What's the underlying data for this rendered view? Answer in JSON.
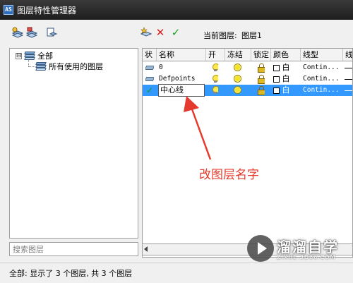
{
  "window": {
    "title": "图层特性管理器",
    "app_icon_letters": "AS"
  },
  "toolbar": {
    "buttons_left": [
      {
        "icon": "new-property-filter-icon"
      },
      {
        "icon": "new-group-filter-icon"
      },
      {
        "icon": "layer-states-manager-icon"
      }
    ],
    "buttons_right": [
      {
        "icon": "new-layer-icon"
      },
      {
        "icon": "delete-layer-icon"
      },
      {
        "icon": "set-current-icon"
      }
    ],
    "current_layer_label": "当前图层:",
    "current_layer_value": "图层1"
  },
  "tree": {
    "root_toggle": "⊟",
    "root_label": "全部",
    "child_label": "所有使用的图层"
  },
  "search": {
    "placeholder": "搜索图层"
  },
  "table": {
    "columns": [
      "状",
      "名称",
      "开",
      "冻结",
      "锁定",
      "颜色",
      "线型",
      "线"
    ],
    "rows": [
      {
        "status": "layer",
        "name": "0",
        "color": "白",
        "linetype": "Contin...",
        "selected": false
      },
      {
        "status": "layer",
        "name": "Defpoints",
        "color": "白",
        "linetype": "Contin...",
        "selected": false
      },
      {
        "status": "current",
        "name": "中心线",
        "color": "白",
        "linetype": "Contin...",
        "selected": true
      }
    ]
  },
  "status_bar": {
    "text": "全部: 显示了 3 个图层, 共 3 个图层"
  },
  "annotation": {
    "text": "改图层名字",
    "color": "#e53a2e"
  },
  "watermark": {
    "brand": "溜溜自学",
    "url": "ZIXUE.3D66.COM"
  },
  "colors": {
    "selection": "#3399ff",
    "title_bar": "#2a2a2a"
  }
}
